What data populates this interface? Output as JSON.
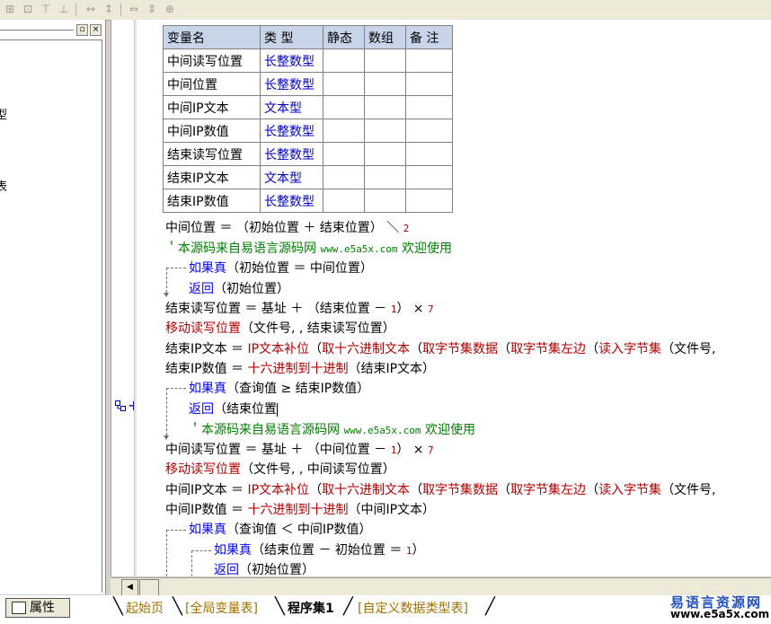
{
  "left_panel": {
    "fragments": [
      "型",
      "表"
    ]
  },
  "gutter": {
    "plus": "+"
  },
  "var_table": {
    "headers": [
      "变量名",
      "类 型",
      "静态",
      "数组",
      "备 注"
    ],
    "rows": [
      {
        "name": "中间读写位置",
        "type": "长整数型"
      },
      {
        "name": "中间位置",
        "type": "长整数型"
      },
      {
        "name": "中间IP文本",
        "type": "文本型"
      },
      {
        "name": "中间IP数值",
        "type": "长整数型"
      },
      {
        "name": "结束读写位置",
        "type": "长整数型"
      },
      {
        "name": "结束IP文本",
        "type": "文本型"
      },
      {
        "name": "结束IP数值",
        "type": "长整数型"
      }
    ]
  },
  "code": {
    "l1": {
      "a": "中间位置 ＝ （初始位置 ＋ 结束位置） ＼ ",
      "n": "2"
    },
    "l2": {
      "c": "＇本源码来自易语言源码网 ",
      "u": "www.e5a5x.com",
      "d": "  欢迎使用"
    },
    "l3": {
      "k": "如果真",
      "t": "（初始位置 ＝ 中间位置）"
    },
    "l4": {
      "k": "返回",
      "t": "（初始位置）"
    },
    "l5": {
      "a": "结束读写位置 ＝ 基址 ＋ （结束位置 － ",
      "n1": "1",
      "b": "） × ",
      "n2": "7"
    },
    "l6": {
      "f": "移动读写位置",
      "t": "（文件号, , 结束读写位置）"
    },
    "l7": {
      "a": "结束IP文本 ＝ ",
      "f1": "IP文本补位",
      "b": "（",
      "f2": "取十六进制文本",
      "c": "（",
      "f3": "取字节集数据",
      "d": "（",
      "f4": "取字节集左边",
      "e": "（",
      "f5": "读入字节集",
      "g": "（文件号,"
    },
    "l8": {
      "a": "结束IP数值 ＝ ",
      "f": "十六进制到十进制",
      "b": "（结束IP文本）"
    },
    "l9": {
      "k": "如果真",
      "t": "（查询值 ≥ 结束IP数值）"
    },
    "l10": {
      "k": "返回",
      "t": "（结束位置"
    },
    "l11": {
      "c": "＇本源码来自易语言源码网 ",
      "u": "www.e5a5x.com",
      "d": "  欢迎使用"
    },
    "l12": {
      "a": "中间读写位置 ＝ 基址 ＋ （中间位置 － ",
      "n1": "1",
      "b": "） × ",
      "n2": "7"
    },
    "l13": {
      "f": "移动读写位置",
      "t": "（文件号, , 中间读写位置）"
    },
    "l14": {
      "a": "中间IP文本 ＝ ",
      "f1": "IP文本补位",
      "b": "（",
      "f2": "取十六进制文本",
      "c": "（",
      "f3": "取字节集数据",
      "d": "（",
      "f4": "取字节集左边",
      "e": "（",
      "f5": "读入字节集",
      "g": "（文件号,"
    },
    "l15": {
      "a": "中间IP数值 ＝ ",
      "f": "十六进制到十进制",
      "b": "（中间IP文本）"
    },
    "l16": {
      "k": "如果真",
      "t": "（查询值 ＜ 中间IP数值）"
    },
    "l17": {
      "k": "如果真",
      "t": "（结束位置 － 初始位置 ＝ ",
      "n": "1",
      "e": "）"
    },
    "l18": {
      "k": "返回",
      "t": "（初始位置）"
    }
  },
  "bottom": {
    "properties_label": "属性",
    "tabs": [
      "起始页",
      "[全局变量表]",
      "程序集1",
      "[自定义数据类型表]"
    ],
    "watermark_1": "易语言资源网",
    "watermark_2": "www.e5a5x.com"
  }
}
